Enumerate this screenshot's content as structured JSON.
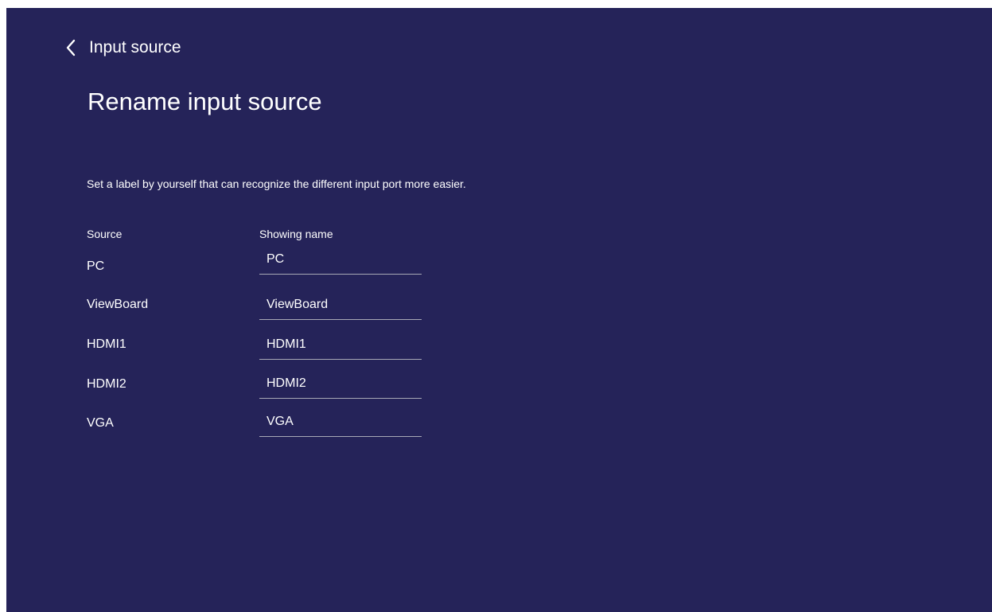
{
  "header": {
    "back_label": "Input source",
    "title": "Rename input source"
  },
  "description": "Set a label by yourself that can recognize the different input port more easier.",
  "table": {
    "headers": {
      "source": "Source",
      "showing_name": "Showing name"
    },
    "rows": [
      {
        "source": "PC",
        "name": "PC"
      },
      {
        "source": "ViewBoard",
        "name": "ViewBoard"
      },
      {
        "source": "HDMI1",
        "name": "HDMI1"
      },
      {
        "source": "HDMI2",
        "name": "HDMI2"
      },
      {
        "source": "VGA",
        "name": "VGA"
      }
    ]
  },
  "colors": {
    "background": "#252359",
    "text": "#ffffff",
    "underline": "#a7a8b6"
  },
  "icons": {
    "back": "chevron-left-icon"
  }
}
